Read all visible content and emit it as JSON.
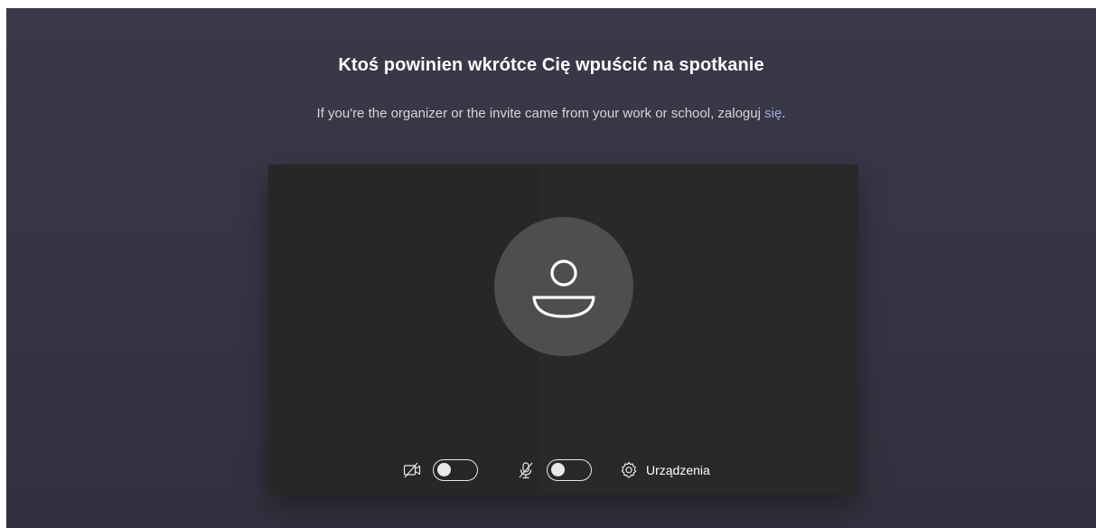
{
  "heading": "Ktoś powinien wkrótce Cię wpuścić na spotkanie",
  "subheading": {
    "text": "If you're the organizer or the invite came from your work or school, zaloguj ",
    "link": "się",
    "suffix": "."
  },
  "controls": {
    "camera": {
      "icon": "camera-off-icon",
      "enabled": false
    },
    "microphone": {
      "icon": "mic-off-icon",
      "enabled": false
    },
    "devices": {
      "icon": "gear-icon",
      "label": "Urządzenia"
    }
  },
  "avatar": {
    "icon": "person-icon"
  },
  "colors": {
    "background": "#353443",
    "preview": "#292929",
    "avatar": "#4e4e4e",
    "link": "#a6a7dc"
  }
}
